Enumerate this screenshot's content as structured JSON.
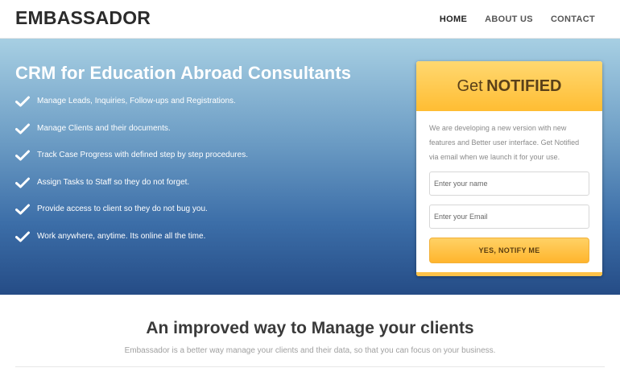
{
  "header": {
    "brand": "EMBASSADOR",
    "nav": [
      {
        "label": "HOME",
        "active": true
      },
      {
        "label": "ABOUT US",
        "active": false
      },
      {
        "label": "CONTACT",
        "active": false
      }
    ]
  },
  "hero": {
    "title": "CRM for Education Abroad Consultants",
    "features": [
      "Manage Leads, Inquiries, Follow-ups and Registrations.",
      "Manage Clients and their documents.",
      "Track Case Progress with defined step by step procedures.",
      "Assign Tasks to Staff so they do not forget.",
      "Provide access to client so they do not bug you.",
      "Work anywhere, anytime. Its online all the time."
    ],
    "feature_icon": "check-icon"
  },
  "signup": {
    "title_prefix": "Get",
    "title_emphasis": "NOTIFIED",
    "description": "We are developing a new version with new features and Better user interface. Get Notified via email when we launch it for your use.",
    "name_placeholder": "Enter your name",
    "email_placeholder": "Enter your Email",
    "button_label": "YES, NOTIFY ME"
  },
  "section": {
    "title": "An improved way to Manage your clients",
    "subtitle": "Embassador is a better way manage your clients and their data, so that you can focus on your business."
  },
  "colors": {
    "accent": "#ffbd33",
    "hero_top": "#a7cfe3",
    "hero_bottom": "#254c86"
  }
}
